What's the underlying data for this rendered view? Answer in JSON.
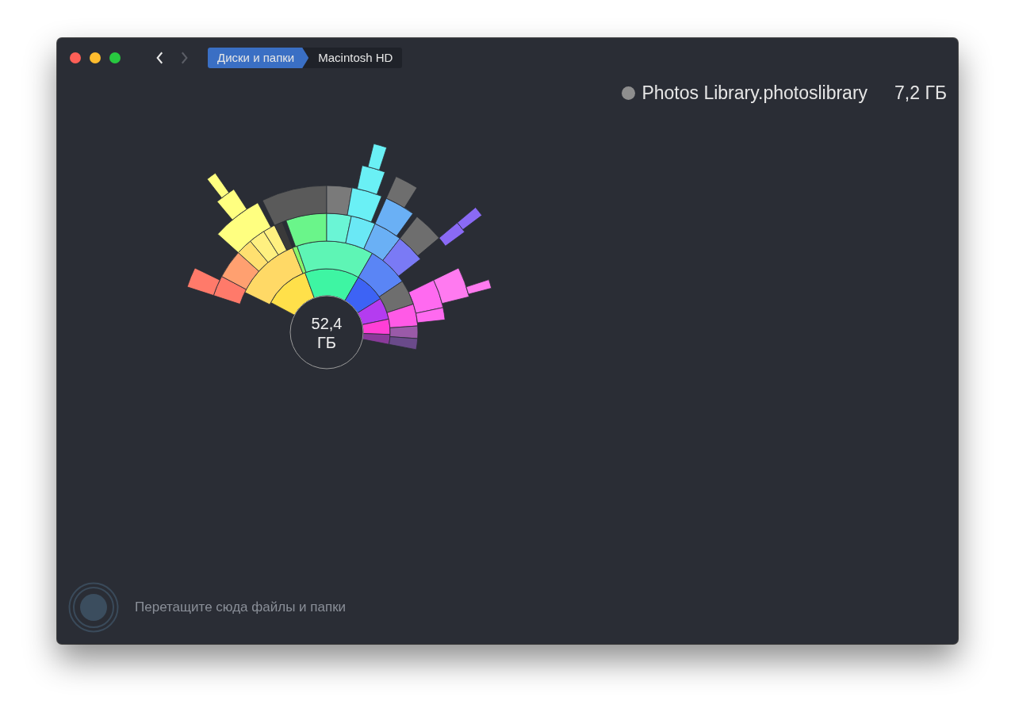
{
  "navigation": {
    "back_disabled": false,
    "forward_disabled": true
  },
  "breadcrumbs": [
    {
      "label": "Диски и папки",
      "selected": true
    },
    {
      "label": "Macintosh HD",
      "selected": false
    }
  ],
  "hovered_item": {
    "name": "Photos Library.photoslibrary",
    "size": "7,2 ГБ"
  },
  "total": {
    "value": "52,4",
    "unit": "ГБ"
  },
  "drop_hint": "Перетащите сюда файлы и папки"
}
